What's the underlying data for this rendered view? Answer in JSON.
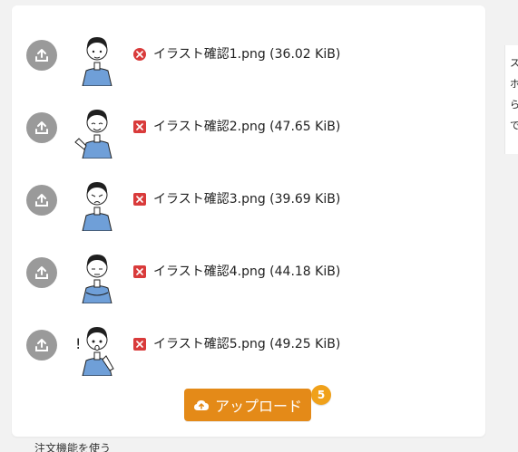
{
  "files": [
    {
      "name": "イラスト確認1.png (36.02 KiB)",
      "remove_shape": "circle",
      "pose": "standing"
    },
    {
      "name": "イラスト確認2.png (47.65 KiB)",
      "remove_shape": "square",
      "pose": "smiling-hand"
    },
    {
      "name": "イラスト確認3.png (39.69 KiB)",
      "remove_shape": "square",
      "pose": "worried"
    },
    {
      "name": "イラスト確認4.png (44.18 KiB)",
      "remove_shape": "square",
      "pose": "arms-crossed"
    },
    {
      "name": "イラスト確認5.png (49.25 KiB)",
      "remove_shape": "square",
      "pose": "surprised"
    }
  ],
  "upload_button": {
    "label": "アップロード",
    "badge_count": "5"
  },
  "right_side": {
    "text_lines": [
      "ス",
      "ホ",
      "ら",
      "で"
    ]
  },
  "bottom_partial_text": "注文機能を使う",
  "colors": {
    "background": "#f2f2f2",
    "panel": "#ffffff",
    "upload_icon_bg": "#9a9a9a",
    "remove_icon": "#d93b3b",
    "upload_button": "#e48a18",
    "badge": "#f0a11a",
    "shirt": "#6f9fd8"
  }
}
